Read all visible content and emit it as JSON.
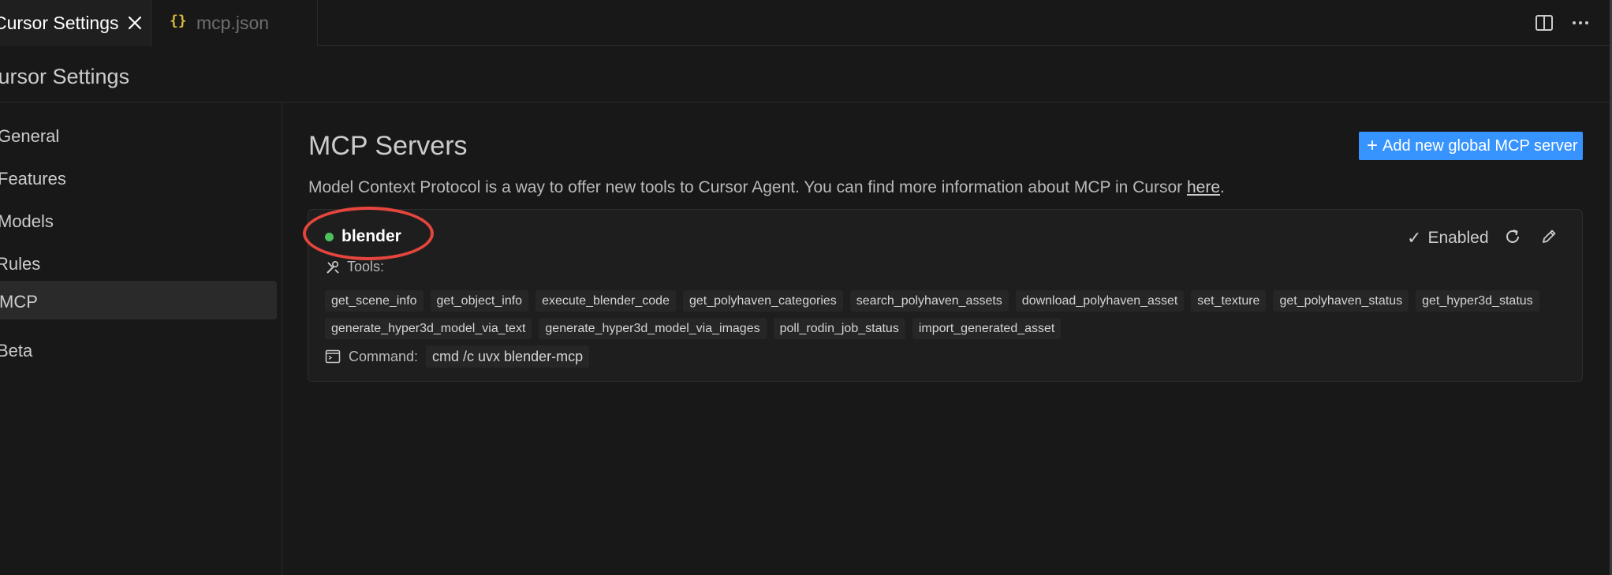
{
  "tabs": [
    {
      "label": "Cursor Settings",
      "active": true
    },
    {
      "label": "mcp.json",
      "active": false,
      "icon": "json-braces-icon",
      "icon_glyph": "{}"
    }
  ],
  "page": {
    "title": "Cursor Settings"
  },
  "sidebar": {
    "items": [
      {
        "label": "General",
        "active": false
      },
      {
        "label": "Features",
        "active": false
      },
      {
        "label": "Models",
        "active": false
      },
      {
        "label": "Rules",
        "active": false
      },
      {
        "label": "MCP",
        "active": true
      },
      {
        "label": "Beta",
        "active": false
      }
    ]
  },
  "main": {
    "title": "MCP Servers",
    "add_button": "Add new global MCP server",
    "description": "Model Context Protocol is a way to offer new tools to Cursor Agent. You can find more information about MCP in Cursor ",
    "description_link": "here",
    "description_end": "."
  },
  "server": {
    "name": "blender",
    "status_color": "#4ec05c",
    "enabled_label": "Enabled",
    "tools_label": "Tools:",
    "tools": [
      "get_scene_info",
      "get_object_info",
      "execute_blender_code",
      "get_polyhaven_categories",
      "search_polyhaven_assets",
      "download_polyhaven_asset",
      "set_texture",
      "get_polyhaven_status",
      "get_hyper3d_status",
      "generate_hyper3d_model_via_text",
      "generate_hyper3d_model_via_images",
      "poll_rodin_job_status",
      "import_generated_asset"
    ],
    "command_label": "Command:",
    "command": "cmd /c uvx blender-mcp"
  },
  "colors": {
    "accent": "#3794ff",
    "highlight": "#e5453d",
    "background": "#181818"
  }
}
